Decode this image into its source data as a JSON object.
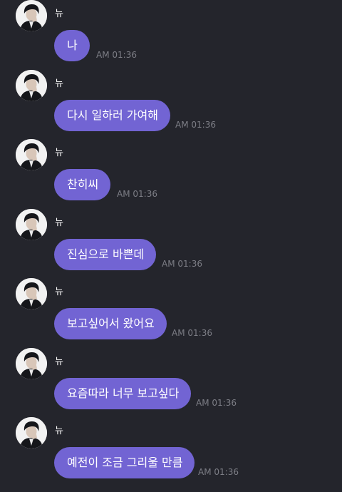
{
  "sender_name": "뉴",
  "colors": {
    "background": "#24252c",
    "bubble": "#7264d3",
    "bubble_text": "#ffffff",
    "timestamp": "#7d7e86"
  },
  "messages": [
    {
      "text": "나",
      "time": "AM 01:36"
    },
    {
      "text": "다시 일하러 가여해",
      "time": "AM 01:36"
    },
    {
      "text": "찬히씨",
      "time": "AM 01:36"
    },
    {
      "text": "진심으로 바쁜데",
      "time": "AM 01:36"
    },
    {
      "text": "보고싶어서 왔어요",
      "time": "AM 01:36"
    },
    {
      "text": "요즘따라 너무 보고싶다",
      "time": "AM 01:36"
    },
    {
      "text": "예전이 조금 그리울 만큼",
      "time": "AM 01:36"
    }
  ]
}
